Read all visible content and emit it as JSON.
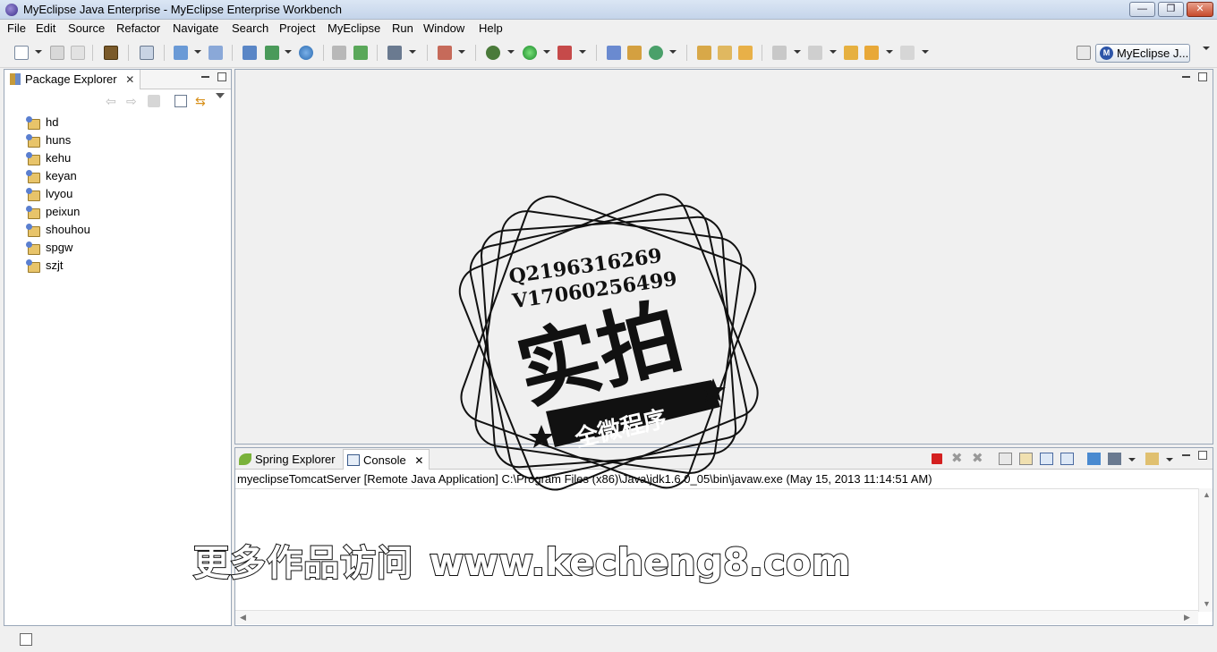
{
  "window": {
    "title": "MyEclipse Java Enterprise - MyEclipse Enterprise Workbench",
    "minimize_glyph": "—",
    "restore_glyph": "❐",
    "close_glyph": "✕"
  },
  "menu": [
    "File",
    "Edit",
    "Source",
    "Refactor",
    "Navigate",
    "Search",
    "Project",
    "MyEclipse",
    "Run",
    "Window",
    "Help"
  ],
  "perspective": {
    "label": "MyEclipse J...",
    "icon_letter": "M"
  },
  "package_explorer": {
    "tab_label": "Package Explorer",
    "close_glyph": "✕",
    "projects": [
      "hd",
      "huns",
      "kehu",
      "keyan",
      "lvyou",
      "peixun",
      "shouhou",
      "spgw",
      "szjt"
    ]
  },
  "console": {
    "tabs": [
      {
        "label": "Spring Explorer",
        "icon": "spring-leaf-icon"
      },
      {
        "label": "Console",
        "icon": "console-icon"
      }
    ],
    "close_glyph": "✕",
    "process": "myeclipseTomcatServer [Remote Java Application] C:\\Program Files (x86)\\Java\\jdk1.6.0_05\\bin\\javaw.exe (May 15, 2013 11:14:51 AM)"
  },
  "watermark": {
    "line1": "Q2196316269",
    "line2": "V17060256499",
    "big": "实拍",
    "ribbon": "全微程序",
    "footer_cn": "更多作品访问",
    "footer_url": "www.kecheng8.com"
  },
  "colors": {
    "titlebar": "#c4d4ea",
    "close": "#c74a2b",
    "terminate": "#d42020"
  }
}
